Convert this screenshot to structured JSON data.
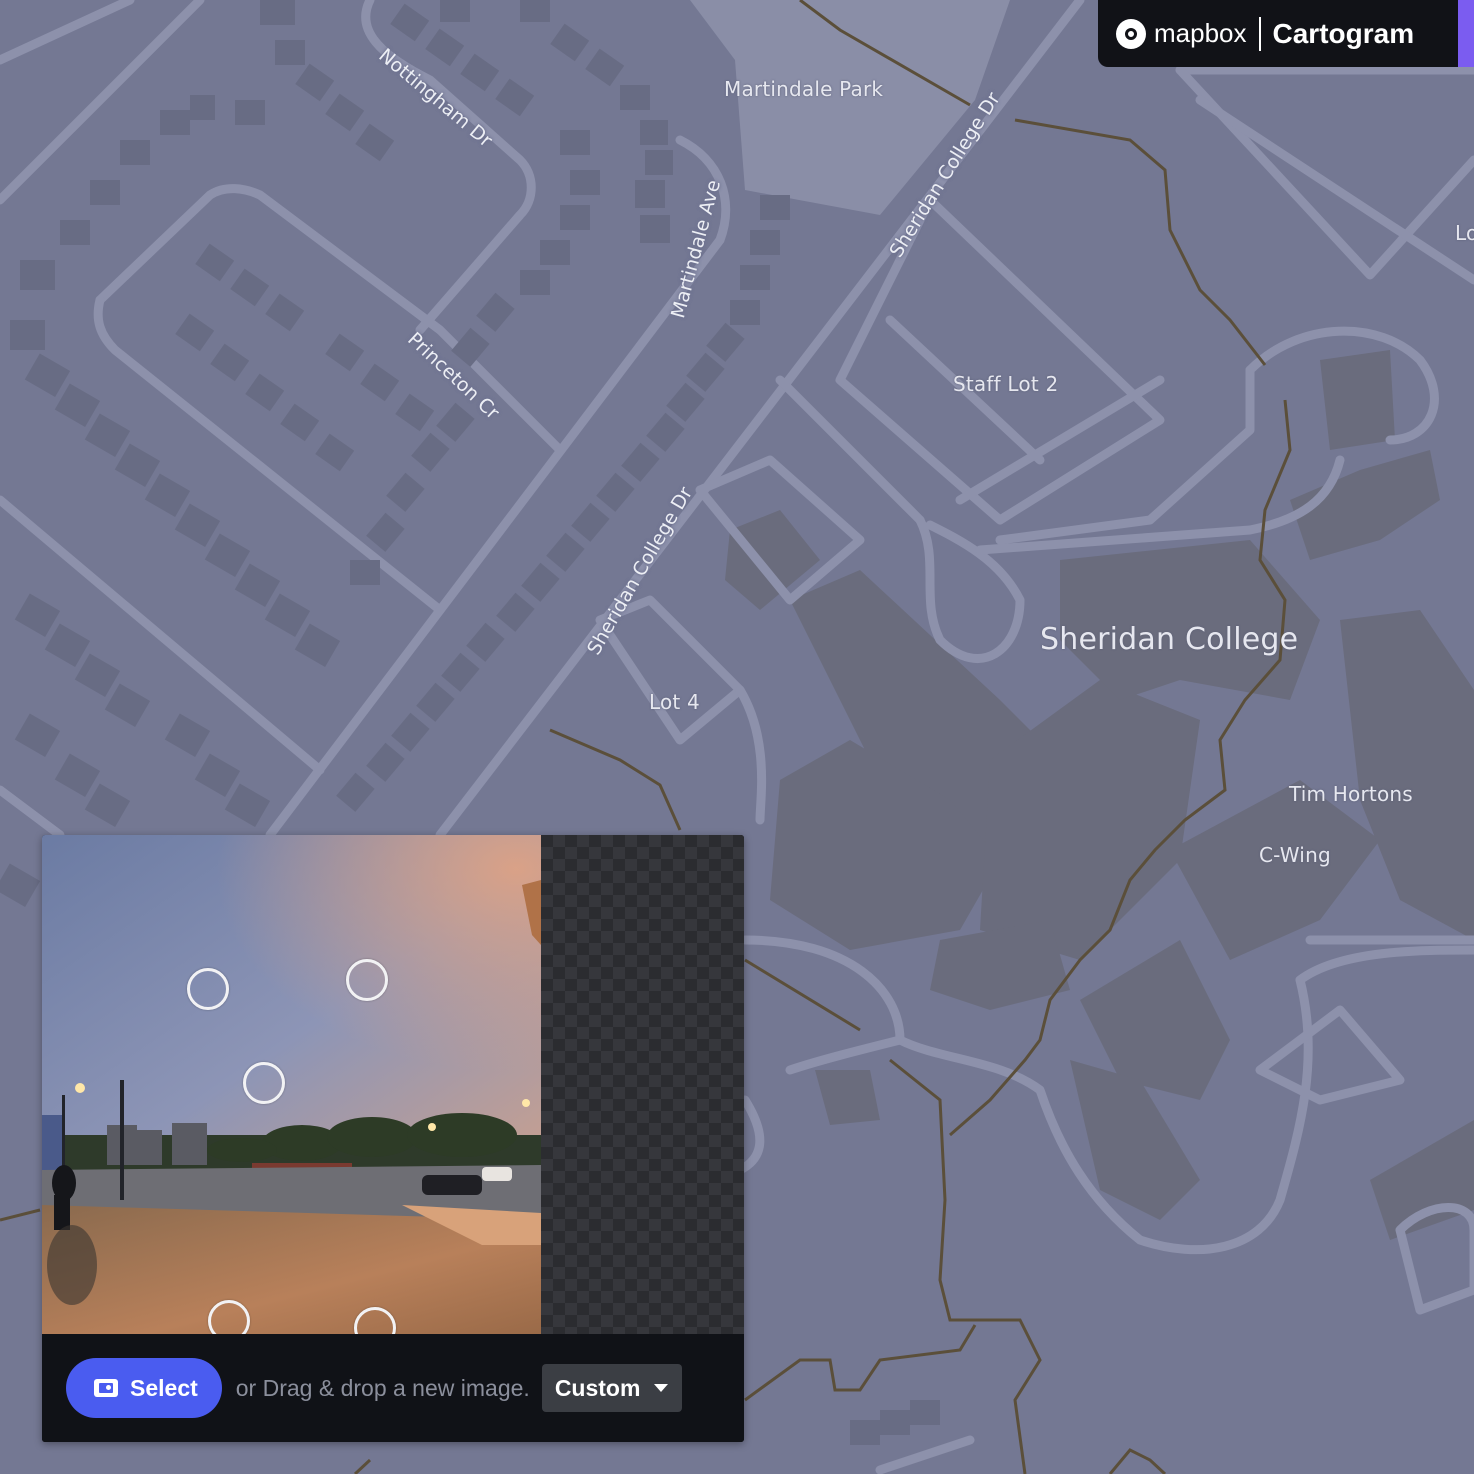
{
  "brand": {
    "logo_word": "mapbox",
    "product": "Cartogram",
    "accent_color": "#7b5cf0"
  },
  "map": {
    "labels": {
      "martindale_park": "Martindale Park",
      "staff_lot_2": "Staff Lot 2",
      "sheridan_college": "Sheridan College",
      "lot_4": "Lot 4",
      "tim_hortons": "Tim Hortons",
      "c_wing": "C-Wing",
      "edge_label": "Lo"
    },
    "roads": {
      "nottingham": "Nottingham Dr",
      "princeton": "Princeton Cr",
      "martindale_ave": "Martindale Ave",
      "sheridan_upper": "Sheridan College Dr",
      "sheridan_lower": "Sheridan College Dr"
    },
    "colors": {
      "land": "#747893",
      "road": "#8d91ab",
      "building": "#686c84",
      "campus_building": "#6b6d7e",
      "path": "#5a4e3a"
    }
  },
  "panel": {
    "select_label": "Select",
    "select_icon": "image-icon",
    "drop_text": "or Drag & drop a new image.",
    "preset_value": "Custom",
    "preset_icon": "chevron-down-icon"
  }
}
